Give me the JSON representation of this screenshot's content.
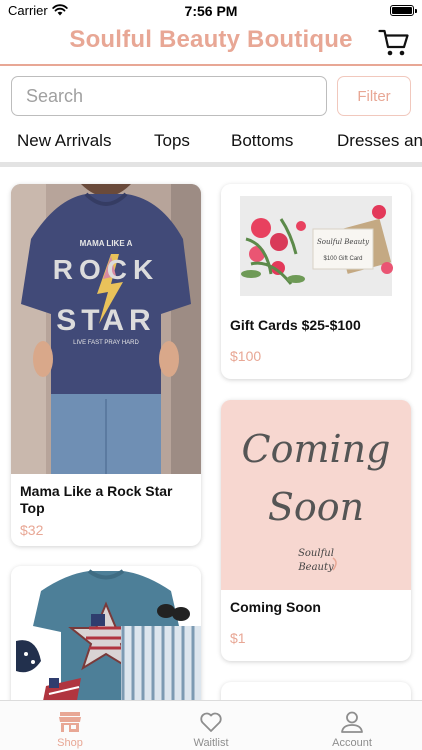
{
  "status_bar": {
    "carrier": "Carrier",
    "time": "7:56 PM"
  },
  "header": {
    "title": "Soulful Beauty Boutique",
    "cart_icon": "cart-icon"
  },
  "search": {
    "placeholder": "Search",
    "value": "",
    "filter_label": "Filter"
  },
  "categories": [
    "New Arrivals",
    "Tops",
    "Bottoms",
    "Dresses and"
  ],
  "products": [
    {
      "name": "Mama Like a Rock Star Top",
      "price": "$32",
      "image": {
        "shirt_line1": "MAMA LIKE A",
        "shirt_line2": "ROCK",
        "shirt_line3": "STAR",
        "shirt_line4": "LIVE FAST PRAY HARD"
      }
    },
    {
      "name": "Gift Cards $25-$100",
      "price": "$100",
      "image": {
        "card_brand": "Soulful Beauty",
        "card_text": "$100 Gift Card"
      }
    },
    {
      "name": "Coming Soon",
      "price": "$1",
      "image": {
        "line1": "Coming",
        "line2": "Soon",
        "logo_line1": "Soulful",
        "logo_line2": "Beauty"
      }
    },
    {
      "name": "",
      "price": "",
      "image": {}
    }
  ],
  "tab_bar": {
    "tabs": [
      {
        "label": "Shop",
        "icon": "shop-icon",
        "active": true
      },
      {
        "label": "Waitlist",
        "icon": "heart-icon",
        "active": false
      },
      {
        "label": "Account",
        "icon": "person-icon",
        "active": false
      }
    ]
  },
  "colors": {
    "accent": "#e8a795",
    "coming_soon_bg": "#f7d7d0",
    "shirt": "#414a78"
  }
}
